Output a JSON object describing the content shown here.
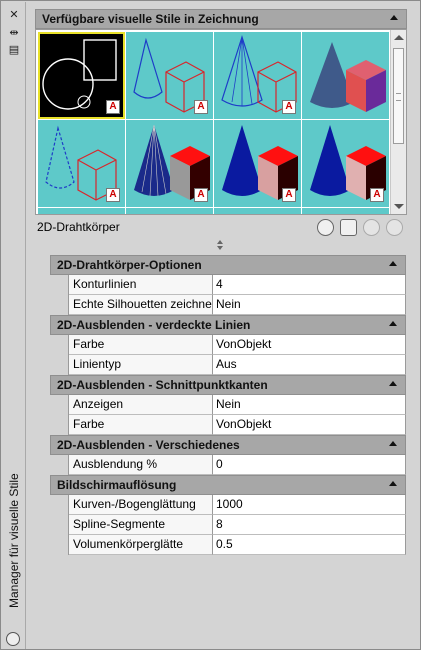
{
  "palette": {
    "title": "Manager für visuelle Stile",
    "pin_icon": "auto-hide-icon",
    "properties_icon": "properties-icon"
  },
  "gallery": {
    "header": "Verfügbare visuelle Stile in Zeichnung",
    "selected_style": "2D-Drahtkörper",
    "thumbnails": [
      {
        "style": "wireframe-2d",
        "selected": true
      },
      {
        "style": "wireframe-3d"
      },
      {
        "style": "hidden-cone-wire"
      },
      {
        "style": "realistic"
      },
      {
        "style": "wireframe-hidden"
      },
      {
        "style": "shaded-checker"
      },
      {
        "style": "shaded-blue"
      },
      {
        "style": "shaded-pink"
      }
    ],
    "tools": [
      "create-style-icon",
      "apply-to-viewport-icon",
      "export-to-palette-icon",
      "delete-style-icon"
    ]
  },
  "sections": [
    {
      "title": "2D-Drahtkörper-Optionen",
      "rows": [
        {
          "key": "Konturlinien",
          "value": "4"
        },
        {
          "key": "Echte Silhouetten zeichnen",
          "value": "Nein"
        }
      ]
    },
    {
      "title": "2D-Ausblenden - verdeckte Linien",
      "rows": [
        {
          "key": "Farbe",
          "value": "VonObjekt"
        },
        {
          "key": "Linientyp",
          "value": "Aus"
        }
      ]
    },
    {
      "title": "2D-Ausblenden - Schnittpunktkanten",
      "rows": [
        {
          "key": "Anzeigen",
          "value": "Nein"
        },
        {
          "key": "Farbe",
          "value": "VonObjekt"
        }
      ]
    },
    {
      "title": "2D-Ausblenden - Verschiedenes",
      "rows": [
        {
          "key": "Ausblendung %",
          "value": "0"
        }
      ]
    },
    {
      "title": "Bildschirmauflösung",
      "rows": [
        {
          "key": "Kurven-/Bogenglättung",
          "value": "1000"
        },
        {
          "key": "Spline-Segmente",
          "value": "8"
        },
        {
          "key": "Volumenkörperglätte",
          "value": "0.5"
        }
      ]
    }
  ]
}
